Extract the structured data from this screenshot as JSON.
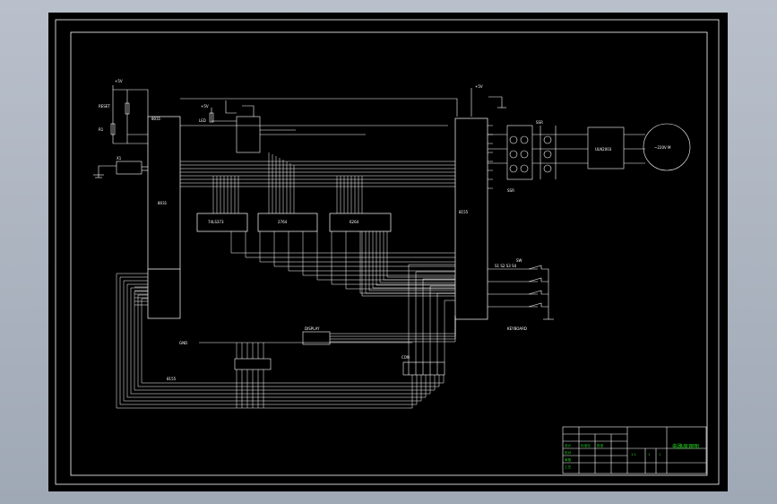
{
  "drawing": {
    "chip_labels": {
      "mcu": "8031",
      "latch": "74LS373",
      "eprom": "2764",
      "ram": "6264",
      "pio": "8155",
      "driver": "ULN2003"
    },
    "pin_labels": {
      "vcc": "+5V",
      "reset": "RESET",
      "crystal": "X1",
      "resistor": "R1",
      "led": "LED",
      "motor": "~220V M",
      "ssr": "SSR",
      "keys": "S1 S2 S3 S4",
      "keyboard": "KEYBOARD",
      "display": "DISPLAY",
      "switch": "SW",
      "ground": "GND",
      "plug": "CON"
    },
    "title_block": {
      "title": "电路原理图",
      "rows": [
        "设计",
        "校对",
        "审核",
        "工艺",
        "标准化",
        "批准"
      ],
      "scale": "1:1",
      "sheet": "1",
      "sheets": "1"
    }
  }
}
